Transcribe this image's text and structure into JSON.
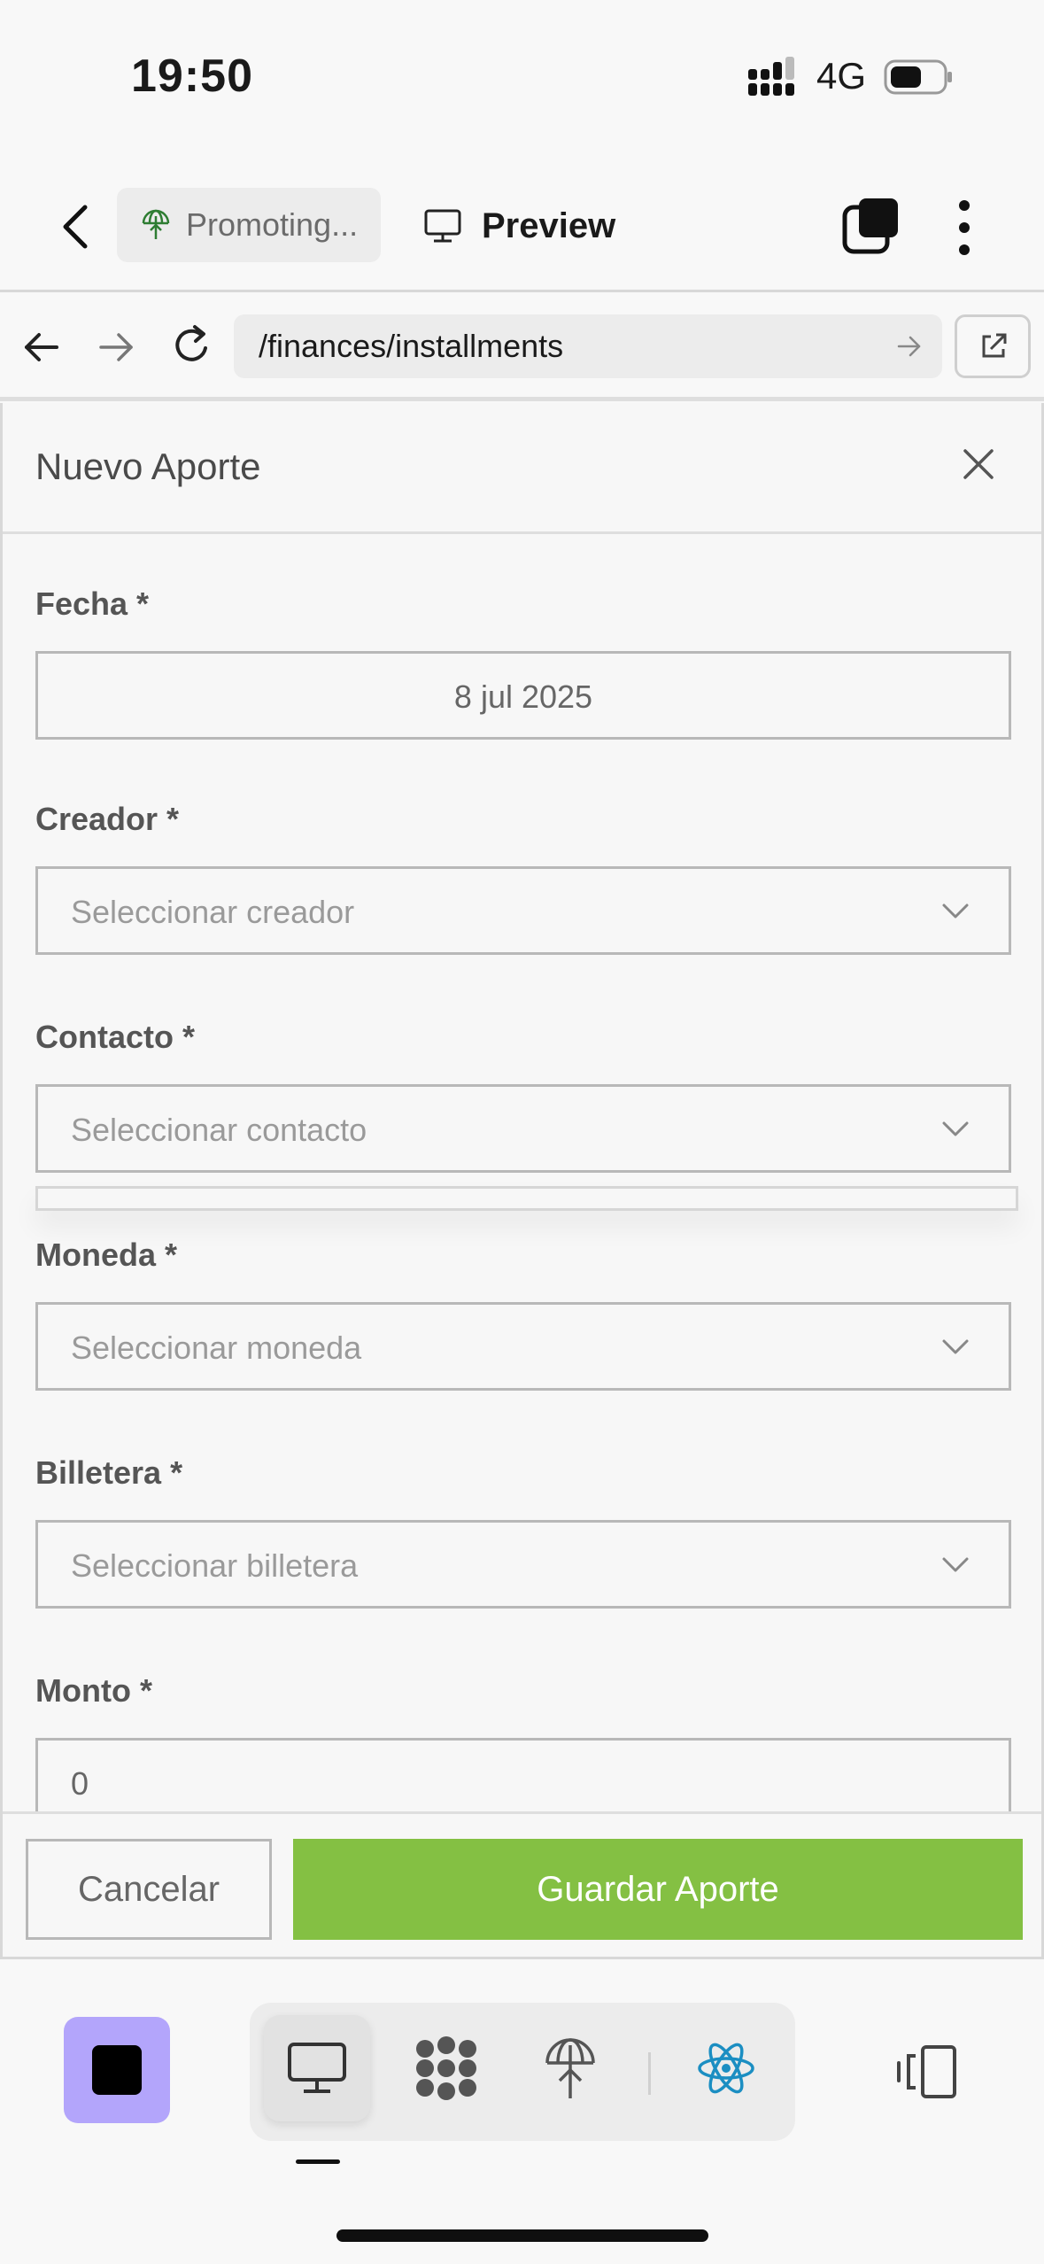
{
  "status_bar": {
    "time": "19:50",
    "network": "4G",
    "icons": [
      "signal-icon",
      "battery-icon"
    ]
  },
  "topbar": {
    "project_name": "Promoting...",
    "preview_label": "Preview",
    "icons": [
      "back-chevron-icon",
      "globe-sprout-icon",
      "monitor-icon",
      "tabs-icon",
      "more-vertical-icon"
    ],
    "accent_color": "#2e7d32"
  },
  "browser": {
    "url": "/finances/installments",
    "icons": [
      "arrow-left-icon",
      "arrow-right-icon",
      "reload-icon",
      "go-arrow-icon",
      "external-link-icon"
    ]
  },
  "modal": {
    "title": "Nuevo Aporte",
    "fields": [
      {
        "label": "Fecha *",
        "value": "8 jul 2025",
        "type": "date"
      },
      {
        "label": "Creador *",
        "placeholder": "Seleccionar creador",
        "type": "select"
      },
      {
        "label": "Contacto *",
        "placeholder": "Seleccionar contacto",
        "type": "select"
      },
      {
        "label": "Moneda *",
        "placeholder": "Seleccionar moneda",
        "type": "select"
      },
      {
        "label": "Billetera *",
        "placeholder": "Seleccionar billetera",
        "type": "select"
      },
      {
        "label": "Monto *",
        "value": "0",
        "type": "number"
      }
    ],
    "cancel_label": "Cancelar",
    "save_label": "Guardar Aporte",
    "save_color": "#84c043"
  },
  "bottom_toolbar": {
    "app_icon_color": "#b3a5fb",
    "items": [
      "monitor-icon",
      "cluster-icon",
      "globe-sprout-icon",
      "react-icon"
    ],
    "active_item": "monitor-icon",
    "react_color": "#1b8ec2",
    "right_icon": "device-switch-icon"
  }
}
